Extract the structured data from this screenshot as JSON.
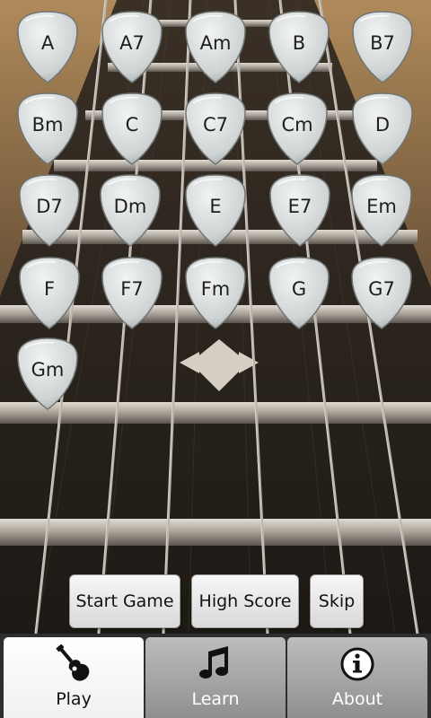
{
  "chords": [
    "A",
    "A7",
    "Am",
    "B",
    "B7",
    "Bm",
    "C",
    "C7",
    "Cm",
    "D",
    "D7",
    "Dm",
    "E",
    "E7",
    "Em",
    "F",
    "F7",
    "Fm",
    "G",
    "G7",
    "Gm"
  ],
  "actions": {
    "start_game": "Start Game",
    "high_score": "High Score",
    "skip": "Skip"
  },
  "tabs": [
    {
      "label": "Play",
      "icon": "guitar-icon",
      "active": true
    },
    {
      "label": "Learn",
      "icon": "music-note-icon",
      "active": false
    },
    {
      "label": "About",
      "icon": "info-icon",
      "active": false
    }
  ],
  "colors": {
    "tab_active": "#ffffff",
    "tab_inactive": "#9e9e9e",
    "pick": "#d8dcdc"
  }
}
